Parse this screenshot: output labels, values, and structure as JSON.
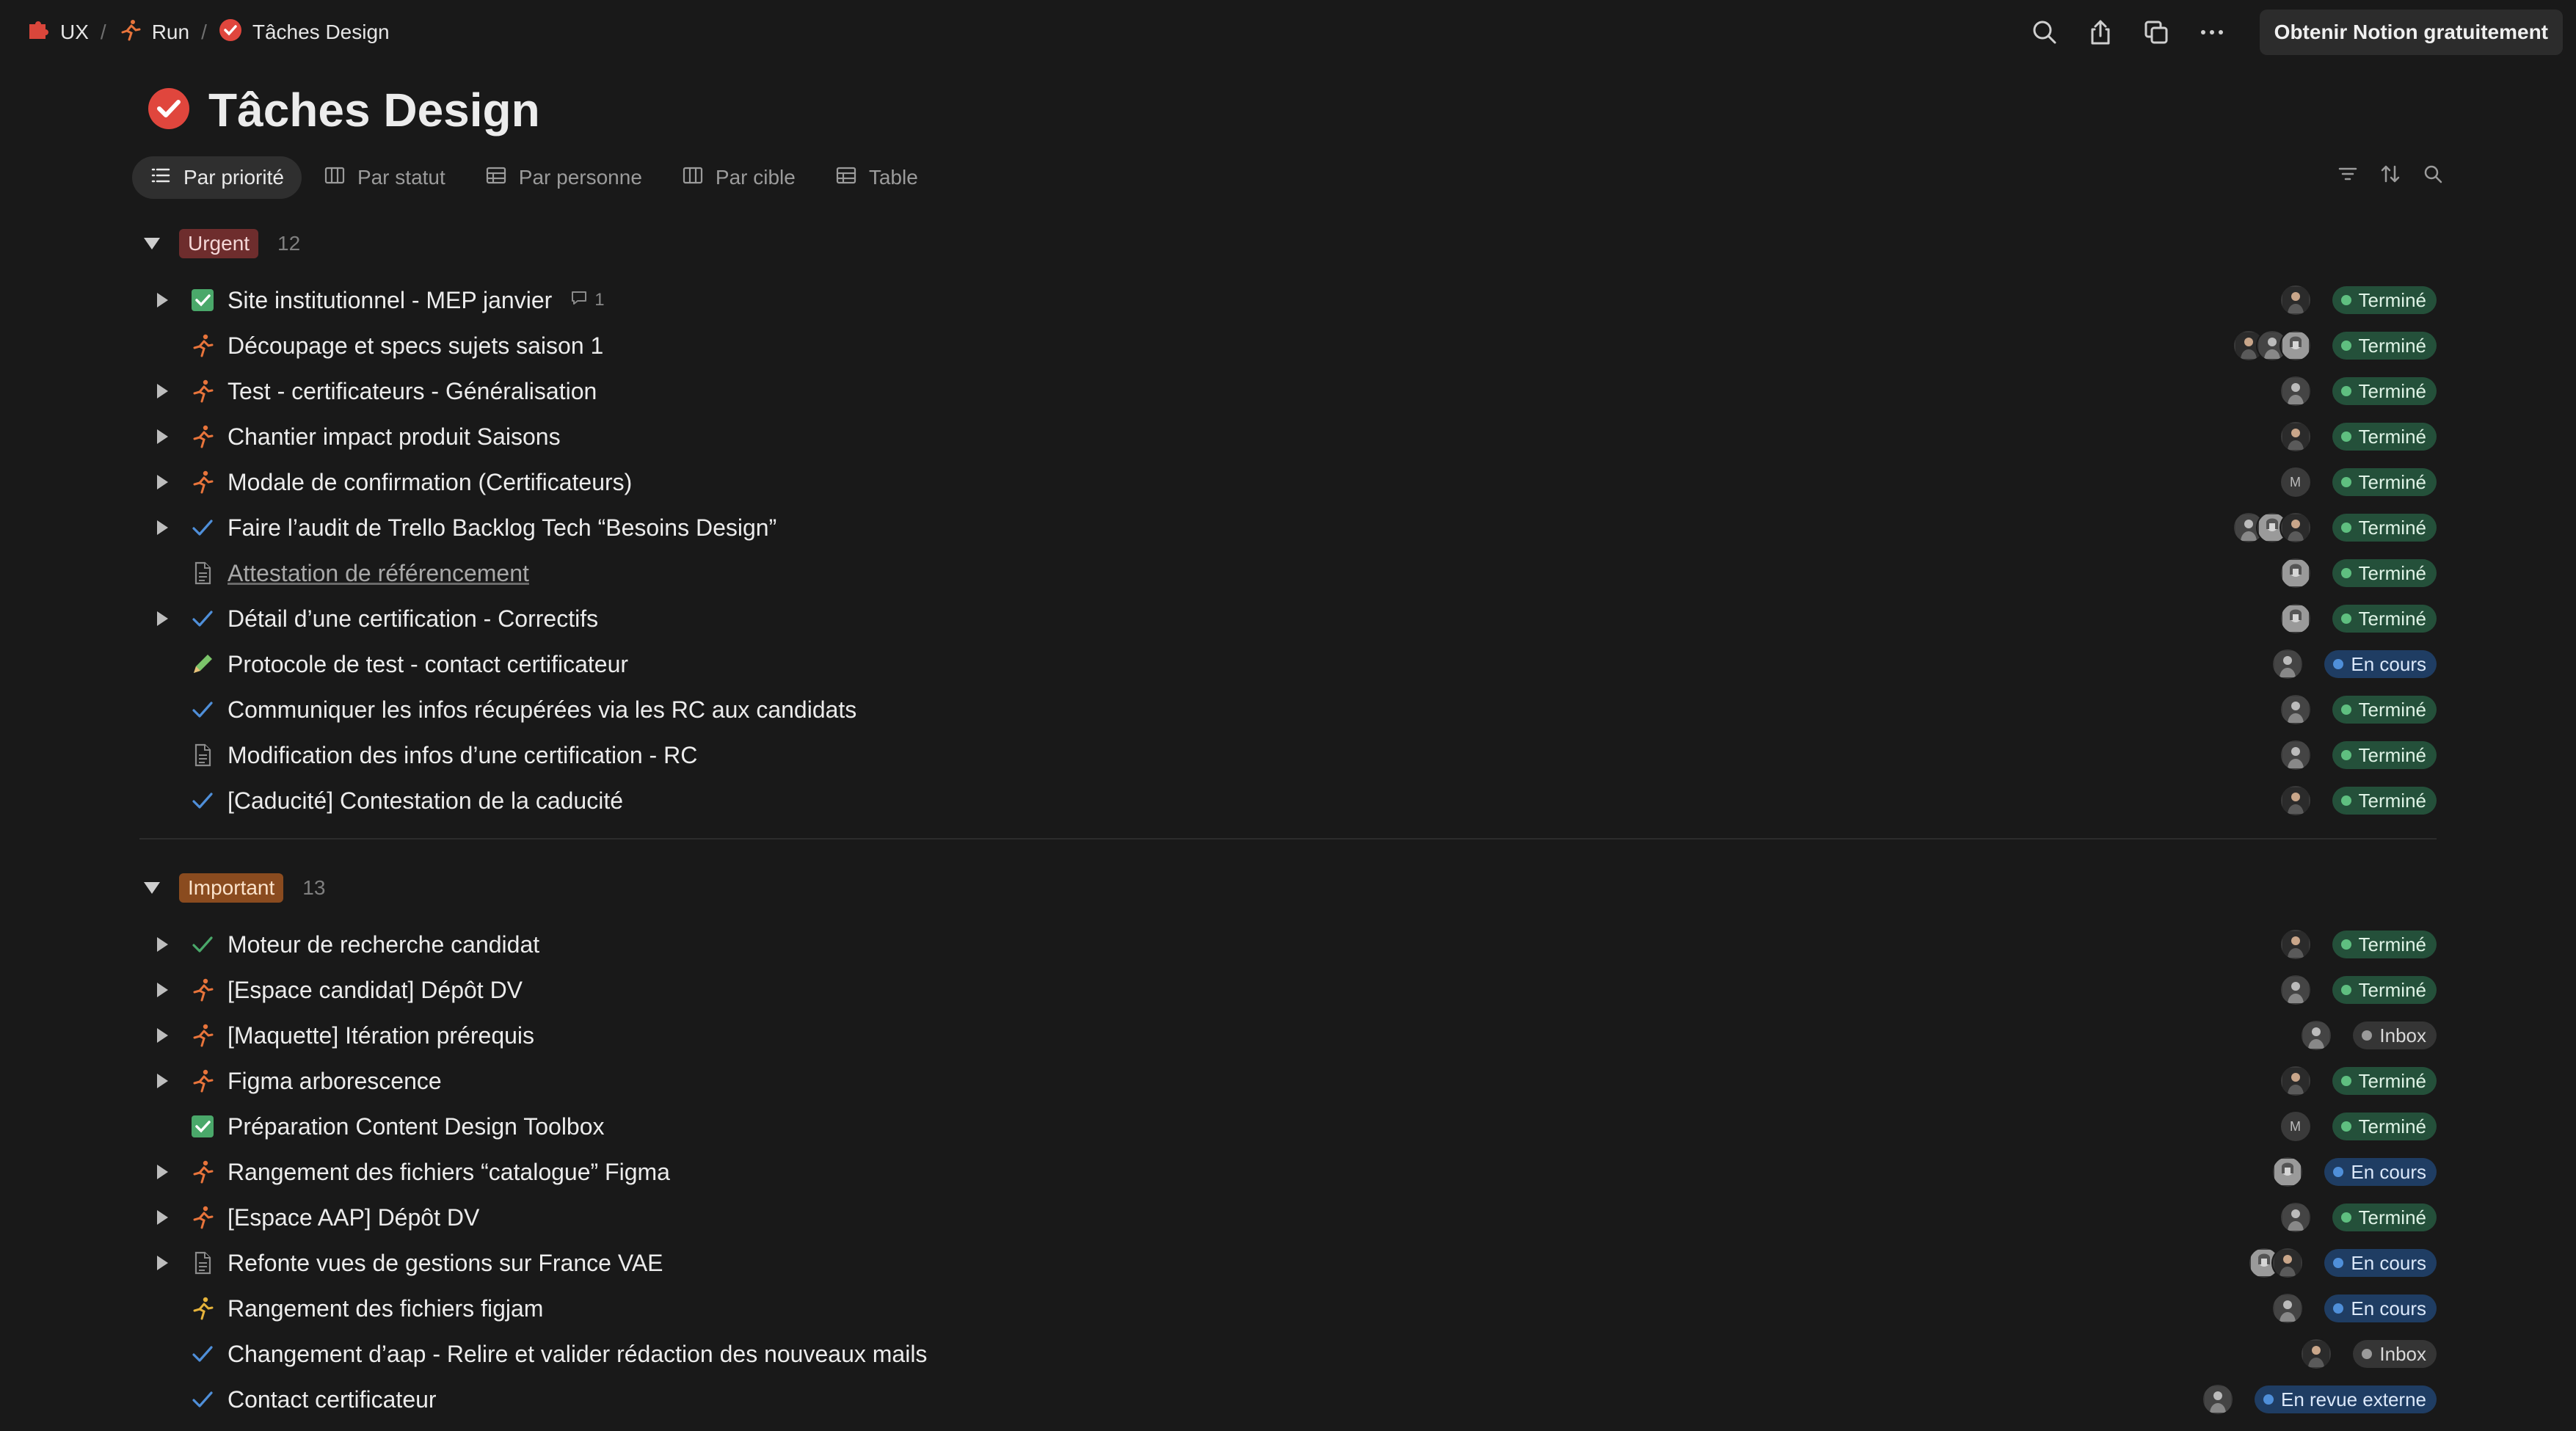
{
  "breadcrumb": [
    {
      "label": "UX",
      "icon": "puzzle-icon"
    },
    {
      "label": "Run",
      "icon": "runner-icon"
    },
    {
      "label": "Tâches Design",
      "icon": "check-circle-icon"
    }
  ],
  "topbar": {
    "actions": [
      "search-icon",
      "share-icon",
      "duplicate-icon",
      "more-icon"
    ],
    "cta_label": "Obtenir Notion gratuitement"
  },
  "page": {
    "title": "Tâches Design",
    "icon": "check-circle-icon"
  },
  "views": [
    {
      "label": "Par priorité",
      "icon": "list-icon",
      "active": true
    },
    {
      "label": "Par statut",
      "icon": "board-icon",
      "active": false
    },
    {
      "label": "Par personne",
      "icon": "table-icon",
      "active": false
    },
    {
      "label": "Par cible",
      "icon": "board-icon",
      "active": false
    },
    {
      "label": "Table",
      "icon": "table-icon",
      "active": false
    }
  ],
  "view_tools": [
    "filter-icon",
    "sort-icon",
    "search-icon"
  ],
  "colors": {
    "background": "#191919",
    "urgent": "#6e2d2d",
    "important": "#8a4b1f",
    "done": "#24503a",
    "in_progress": "#1f3d63"
  },
  "groups": [
    {
      "label": "Urgent",
      "count": "12",
      "style": "urgent",
      "rows": [
        {
          "title": "Site institutionnel - MEP janvier",
          "icon": "checkbox-icon",
          "expandable": true,
          "comments": "1",
          "avatars": [
            "a"
          ],
          "status": "Terminé",
          "status_type": "done"
        },
        {
          "title": "Découpage et specs sujets saison 1",
          "icon": "runner-icon",
          "expandable": false,
          "avatars": [
            "a",
            "b",
            "c"
          ],
          "status": "Terminé",
          "status_type": "done"
        },
        {
          "title": "Test - certificateurs - Généralisation",
          "icon": "runner-icon",
          "expandable": true,
          "avatars": [
            "b"
          ],
          "status": "Terminé",
          "status_type": "done"
        },
        {
          "title": "Chantier impact produit Saisons",
          "icon": "runner-icon",
          "expandable": true,
          "avatars": [
            "a"
          ],
          "status": "Terminé",
          "status_type": "done"
        },
        {
          "title": "Modale de confirmation (Certificateurs)",
          "icon": "runner-icon",
          "expandable": true,
          "avatars": [
            "M"
          ],
          "status": "Terminé",
          "status_type": "done"
        },
        {
          "title": "Faire l’audit de Trello Backlog Tech “Besoins Design”",
          "icon": "check-icon",
          "expandable": true,
          "avatars": [
            "b",
            "c",
            "a"
          ],
          "status": "Terminé",
          "status_type": "done"
        },
        {
          "title": "Attestation de référencement",
          "icon": "page-icon",
          "expandable": false,
          "link": true,
          "avatars": [
            "c"
          ],
          "status": "Terminé",
          "status_type": "done"
        },
        {
          "title": "Détail d’une certification - Correctifs",
          "icon": "check-icon",
          "expandable": true,
          "avatars": [
            "c"
          ],
          "status": "Terminé",
          "status_type": "done"
        },
        {
          "title": "Protocole de test - contact certificateur",
          "icon": "pencil-icon",
          "expandable": false,
          "avatars": [
            "b"
          ],
          "status": "En cours",
          "status_type": "progress"
        },
        {
          "title": "Communiquer les infos récupérées via les RC aux candidats",
          "icon": "check-icon",
          "expandable": false,
          "avatars": [
            "b"
          ],
          "status": "Terminé",
          "status_type": "done"
        },
        {
          "title": "Modification des infos d’une certification - RC",
          "icon": "page-icon",
          "expandable": false,
          "avatars": [
            "b"
          ],
          "status": "Terminé",
          "status_type": "done"
        },
        {
          "title": "[Caducité] Contestation de la caducité",
          "icon": "check-icon",
          "expandable": false,
          "avatars": [
            "a"
          ],
          "status": "Terminé",
          "status_type": "done"
        }
      ]
    },
    {
      "label": "Important",
      "count": "13",
      "style": "important",
      "rows": [
        {
          "title": "Moteur de recherche candidat",
          "icon": "check-green-icon",
          "expandable": true,
          "avatars": [
            "a"
          ],
          "status": "Terminé",
          "status_type": "done"
        },
        {
          "title": "[Espace candidat] Dépôt DV",
          "icon": "runner-icon",
          "expandable": true,
          "avatars": [
            "b"
          ],
          "status": "Terminé",
          "status_type": "done"
        },
        {
          "title": "[Maquette] Itération prérequis",
          "icon": "runner-icon",
          "expandable": true,
          "avatars": [
            "b"
          ],
          "status": "Inbox",
          "status_type": "inbox"
        },
        {
          "title": "Figma arborescence",
          "icon": "runner-icon",
          "expandable": true,
          "avatars": [
            "a"
          ],
          "status": "Terminé",
          "status_type": "done"
        },
        {
          "title": "Préparation Content Design Toolbox",
          "icon": "checkbox-icon",
          "expandable": false,
          "avatars": [
            "M"
          ],
          "status": "Terminé",
          "status_type": "done"
        },
        {
          "title": "Rangement des fichiers “catalogue” Figma",
          "icon": "runner-icon",
          "expandable": true,
          "avatars": [
            "c"
          ],
          "status": "En cours",
          "status_type": "progress"
        },
        {
          "title": "[Espace AAP] Dépôt DV",
          "icon": "runner-icon",
          "expandable": true,
          "avatars": [
            "b"
          ],
          "status": "Terminé",
          "status_type": "done"
        },
        {
          "title": "Refonte vues de gestions sur France VAE",
          "icon": "page-icon",
          "expandable": true,
          "avatars": [
            "c",
            "a"
          ],
          "status": "En cours",
          "status_type": "progress"
        },
        {
          "title": "Rangement des fichiers figjam",
          "icon": "runner-yellow-icon",
          "expandable": false,
          "avatars": [
            "b"
          ],
          "status": "En cours",
          "status_type": "progress"
        },
        {
          "title": "Changement d’aap - Relire et valider rédaction des nouveaux mails",
          "icon": "check-icon",
          "expandable": false,
          "avatars": [
            "a"
          ],
          "status": "Inbox",
          "status_type": "inbox"
        },
        {
          "title": "Contact certificateur",
          "icon": "check-icon",
          "expandable": false,
          "avatars": [
            "b"
          ],
          "status": "En revue externe",
          "status_type": "review"
        }
      ]
    }
  ]
}
